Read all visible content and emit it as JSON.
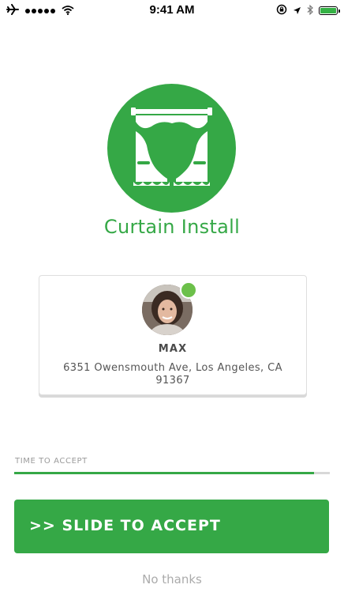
{
  "status_bar": {
    "time": "9:41 AM",
    "icons": [
      "airplane-icon",
      "signal-dots-icon",
      "wifi-icon",
      "rotation-lock-icon",
      "location-icon",
      "bluetooth-icon",
      "battery-icon"
    ],
    "battery_level": 1.0,
    "battery_color": "#35b245"
  },
  "service": {
    "icon": "curtain-icon",
    "title": "Curtain Install",
    "accent_color": "#35a846"
  },
  "customer": {
    "name": "MAX",
    "address": "6351 Owensmouth Ave, Los Angeles, CA 91367",
    "online_status_color": "#6cc04a"
  },
  "timer": {
    "label": "TIME TO ACCEPT",
    "progress": 0.95
  },
  "actions": {
    "slide_label": ">> SLIDE TO ACCEPT",
    "decline_label": "No thanks"
  }
}
